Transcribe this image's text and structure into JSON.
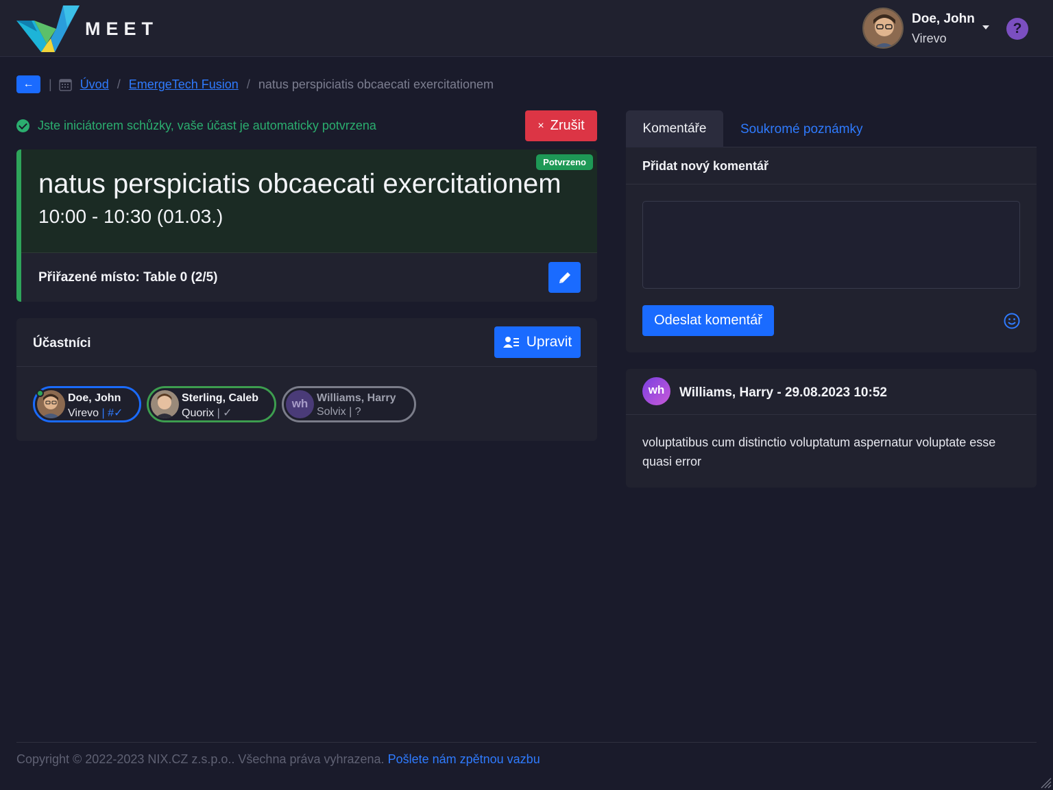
{
  "header": {
    "brand": "MEET",
    "user_name": "Doe, John",
    "user_org": "Virevo",
    "help_label": "?"
  },
  "breadcrumb": {
    "back_arrow": "←",
    "separator": "|",
    "items": [
      "Úvod",
      "EmergeTech Fusion"
    ],
    "slash": "/",
    "current": "natus perspiciatis obcaecati exercitationem"
  },
  "notice": {
    "text": "Jste iniciátorem schůzky, vaše účast je automaticky potvrzena",
    "color": "#2bae6f"
  },
  "cancel_button": {
    "icon": "×",
    "label": "Zrušit",
    "color": "#dc3545"
  },
  "meeting": {
    "status_badge": "Potvrzeno",
    "title": "natus perspiciatis obcaecati exercitationem",
    "time": "10:00 - 10:30 (01.03.)",
    "place": "Přiřazené místo: Table 0 (2/5)",
    "accent_color": "#2ea55a"
  },
  "participants": {
    "title": "Účastníci",
    "edit_label": "Upravit",
    "list": [
      {
        "name": "Doe, John",
        "org": "Virevo",
        "suffix": "#✓",
        "border": "#1a6bff"
      },
      {
        "name": "Sterling, Caleb",
        "org": "Quorix",
        "suffix": "✓",
        "border": "#3d9e4f"
      },
      {
        "name": "Williams, Harry",
        "org": "Solvix",
        "suffix": "?",
        "initials": "wh",
        "border": "#7b7d8a"
      }
    ]
  },
  "comments": {
    "tabs": [
      "Komentáře",
      "Soukromé poznámky"
    ],
    "add_title": "Přidat nový komentář",
    "textarea_value": "",
    "send_label": "Odeslat komentář",
    "posts": [
      {
        "initials": "wh",
        "author_line": "Williams, Harry - 29.08.2023 10:52",
        "body": "voluptatibus cum distinctio voluptatum aspernatur voluptate esse quasi error"
      }
    ]
  },
  "footer": {
    "copyright": "Copyright © 2022-2023 NIX.CZ z.s.p.o.. Všechna práva vyhrazena.",
    "link": "Pošlete nám zpětnou vazbu"
  },
  "icons": [
    "logo-icon",
    "user-avatar",
    "chevron-down-icon",
    "help-icon",
    "back-arrow-icon",
    "calendar-icon",
    "check-circle-icon",
    "close-icon",
    "pencil-icon",
    "user-list-icon",
    "smiley-icon",
    "resize-handle-icon"
  ]
}
